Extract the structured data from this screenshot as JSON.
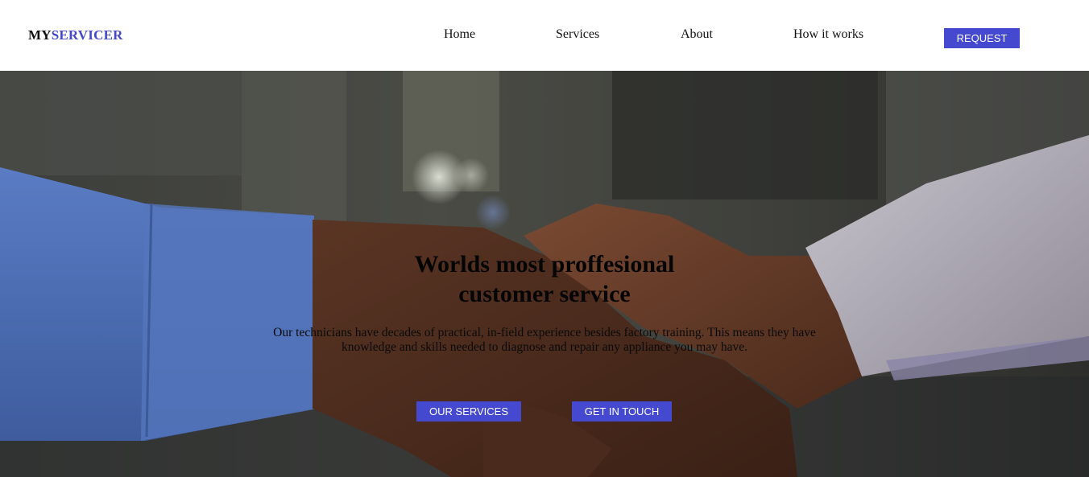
{
  "brand": {
    "prefix": "MY",
    "name": "SERVICER"
  },
  "nav": {
    "home": "Home",
    "services": "Services",
    "about": "About",
    "how_it_works": "How it works",
    "request": "REQUEST"
  },
  "hero": {
    "title_line1": "Worlds most proffesional",
    "title_line2": "customer service",
    "description": "Our technicians have decades of practical, in-field experience besides factory training. This means they have knowledge and skills needed to diagnose and repair any appliance you may have.",
    "buttons": {
      "services": "OUR SERVICES",
      "contact": "GET IN TOUCH"
    },
    "background_image": "handshake-photo"
  },
  "colors": {
    "accent": "#4549cf",
    "text": "#111111",
    "nav_bg": "#ffffff"
  }
}
